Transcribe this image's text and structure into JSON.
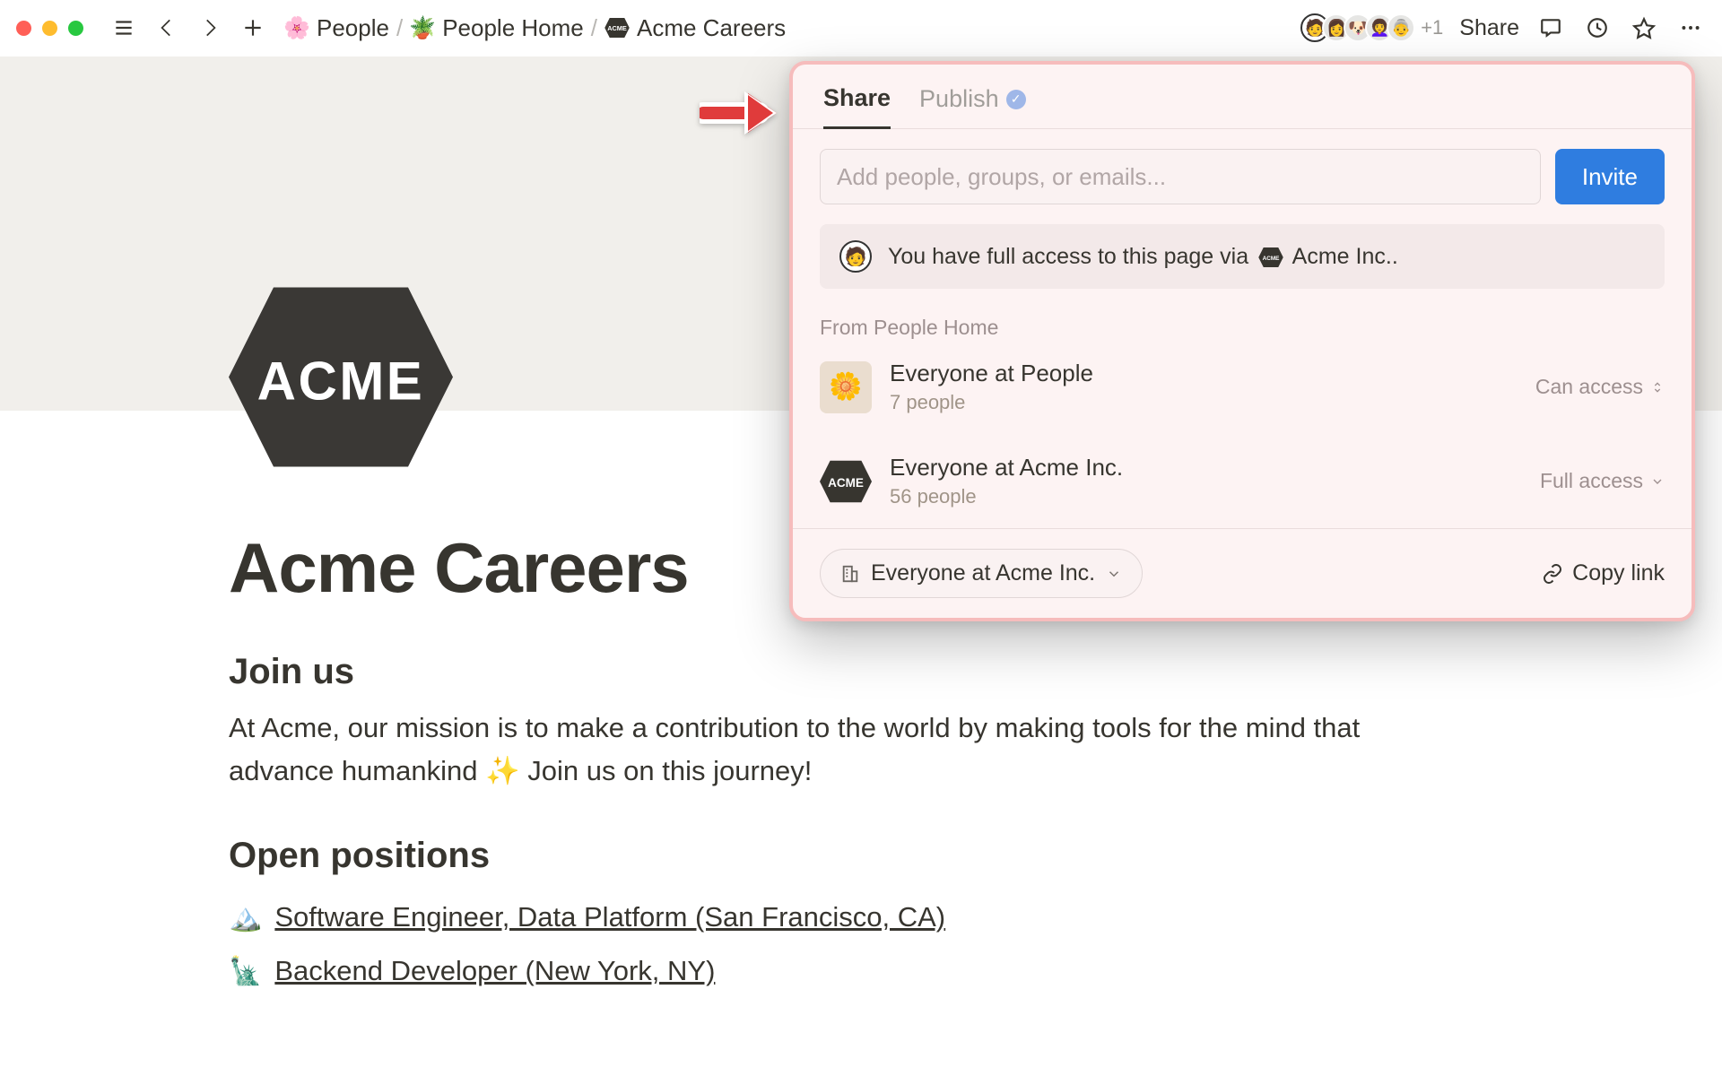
{
  "breadcrumb": {
    "items": [
      {
        "icon": "🌸",
        "label": "People"
      },
      {
        "icon": "🪴",
        "label": "People Home"
      },
      {
        "icon": "acme",
        "label": "Acme Careers"
      }
    ]
  },
  "topbar": {
    "share_label": "Share",
    "more_count": "+1"
  },
  "page": {
    "title": "Acme Careers",
    "join_heading": "Join us",
    "join_body": "At Acme, our mission is to make a contribution to the world by making tools for the mind that advance humankind ✨ Join us on this journey!",
    "positions_heading": "Open positions",
    "positions": [
      {
        "emoji": "🏔️",
        "title": "Software Engineer, Data Platform (San Francisco, CA)"
      },
      {
        "emoji": "🗽",
        "title": "Backend Developer (New York, NY)"
      }
    ]
  },
  "share_popover": {
    "tabs": {
      "share": "Share",
      "publish": "Publish"
    },
    "input_placeholder": "Add people, groups, or emails...",
    "invite_label": "Invite",
    "access_notice_pre": "You have full access to this page via",
    "access_notice_org": "Acme Inc.",
    "section_label": "From People Home",
    "members": [
      {
        "icon": "🌼",
        "name": "Everyone at People",
        "sub": "7 people",
        "perm": "Can access",
        "perm_style": "sort"
      },
      {
        "icon": "acme",
        "name": "Everyone at Acme Inc.",
        "sub": "56 people",
        "perm": "Full access",
        "perm_style": "chevron"
      }
    ],
    "audience_chip": "Everyone at Acme Inc.",
    "copy_link": "Copy link"
  }
}
